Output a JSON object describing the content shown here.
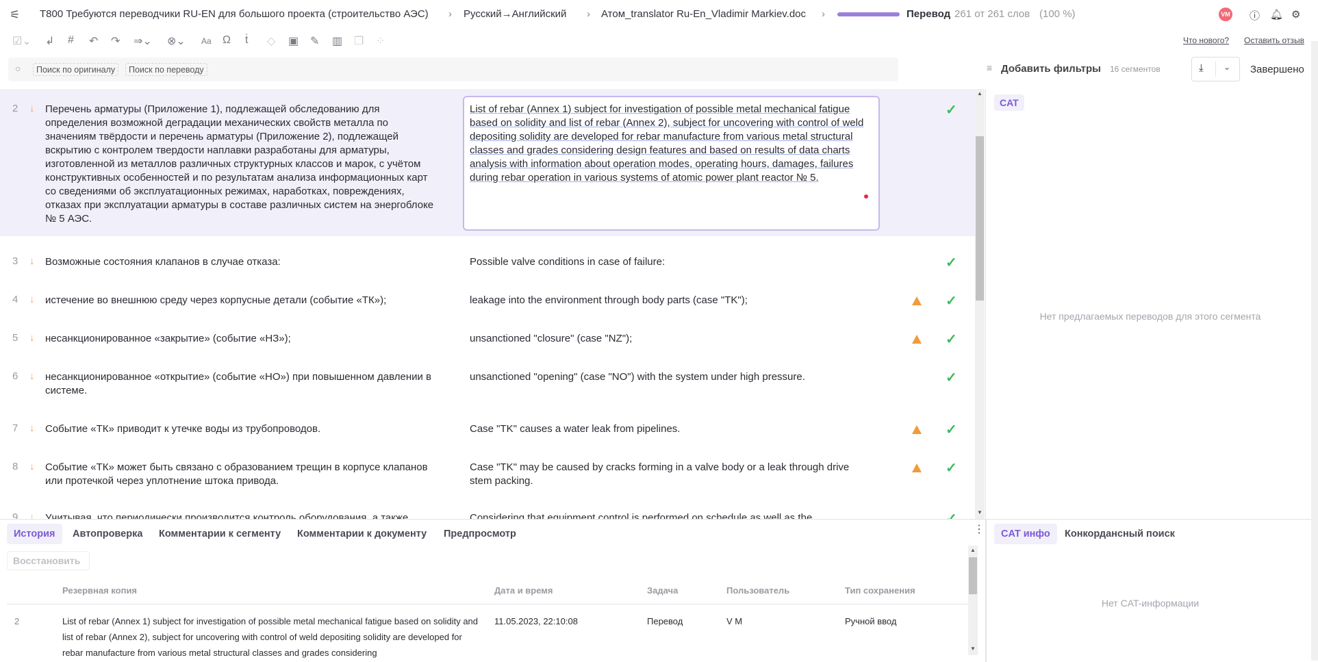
{
  "header": {
    "project": "T800 Требуются переводчики RU-EN для большого проекта (строительство АЭС)",
    "languages": "Русский→Английский",
    "file": "Атом_translator Ru-En_Vladimir Markiev.doc",
    "stage": "Перевод",
    "words": "261 от 261 слов",
    "percent": "(100 %)",
    "progress_percent": 100,
    "avatar": "VM",
    "accent": "#9b7fdc"
  },
  "links": {
    "whats_new": "Что нового?",
    "feedback": "Оставить отзыв"
  },
  "search": {
    "source_placeholder": "Поиск по оригиналу",
    "target_placeholder": "Поиск по переводу",
    "filters": "Добавить фильтры",
    "segments_count": "16 сегментов",
    "complete": "Завершено"
  },
  "segments": [
    {
      "num": "2",
      "source": "Перечень арматуры (Приложение 1), подлежащей обследованию для определения возможной деградации механических свойств металла по значениям твёрдости и перечень арматуры (Приложение 2), подлежащей вскрытию с контролем твердости наплавки разработаны для арматуры, изготовленной из металлов различных структурных классов и марок, с учётом конструктивных особенностей и по результатам анализа информационных карт со сведениями об эксплуатационных режимах, наработках, повреждениях, отказах при эксплуатации арматуры в составе различных систем на энергоблоке № 5 АЭС.",
      "target": "List of rebar (Annex 1) subject for investigation of possible metal mechanical fatigue based on solidity and list of rebar (Annex 2), subject for uncovering with control of weld depositing solidity are developed for rebar manufacture from various metal structural classes and grades considering design features and based on results of data charts analysis with information about operation modes, operating hours, damages, failures during rebar operation in various systems of atomic power plant reactor № 5.",
      "warning": false,
      "confirmed": true
    },
    {
      "num": "3",
      "source": "Возможные состояния клапанов в случае отказа:",
      "target": "Possible valve conditions in case of failure:",
      "warning": false,
      "confirmed": true
    },
    {
      "num": "4",
      "source": "истечение во внешнюю среду через корпусные детали (событие «ТК»);",
      "target": "leakage into the environment through body parts (case \"TK\");",
      "warning": true,
      "confirmed": true
    },
    {
      "num": "5",
      "source": "несанкционированное «закрытие» (событие «НЗ»);",
      "target": "unsanctioned  \"closure\" (case \"NZ\");",
      "warning": true,
      "confirmed": true
    },
    {
      "num": "6",
      "source": "несанкционированное «открытие» (событие «НО») при повышенном давлении в системе.",
      "target": "unsanctioned \"opening\" (case \"NO\") with the system under high pressure.",
      "warning": false,
      "confirmed": true
    },
    {
      "num": "7",
      "source": "Событие «ТК» приводит к утечке воды из трубопроводов.",
      "target": "Case \"TK\" causes a water leak from pipelines.",
      "warning": true,
      "confirmed": true
    },
    {
      "num": "8",
      "source": "Событие «ТК» может быть связано с образованием трещин в корпусе клапанов или протечкой через уплотнение штока привода.",
      "target": "Case \"TK\" may be caused by cracks forming in a valve body or a leak through drive stem packing.",
      "warning": true,
      "confirmed": true
    },
    {
      "num": "9",
      "source": "Учитывая, что периодически производится контроль оборудования, а также",
      "target": "Considering that equipment control is performed on schedule as well as the",
      "warning": false,
      "confirmed": true
    }
  ],
  "right_panel": {
    "cat_tab": "CAT",
    "no_suggestions": "Нет предлагаемых переводов для этого сегмента"
  },
  "bottom": {
    "tabs": [
      "История",
      "Автопроверка",
      "Комментарии к сегменту",
      "Комментарии к документу",
      "Предпросмотр"
    ],
    "restore": "Восстановить",
    "columns": [
      "Резервная копия",
      "Дата и время",
      "Задача",
      "Пользователь",
      "Тип сохранения"
    ],
    "rows": [
      {
        "num": "2",
        "backup": "List of rebar (Annex 1) subject for investigation of possible metal mechanical fatigue based on solidity and list of rebar (Annex 2), subject for uncovering with control of weld depositing solidity are developed for rebar manufacture from various metal structural classes and grades considering",
        "datetime": "11.05.2023, 22:10:08",
        "task": "Перевод",
        "user": "V M",
        "save_type": "Ручной ввод"
      }
    ]
  },
  "bottom_right": {
    "tabs": [
      "CAT инфо",
      "Конкордансный поиск"
    ],
    "empty": "Нет CAT-информации"
  }
}
